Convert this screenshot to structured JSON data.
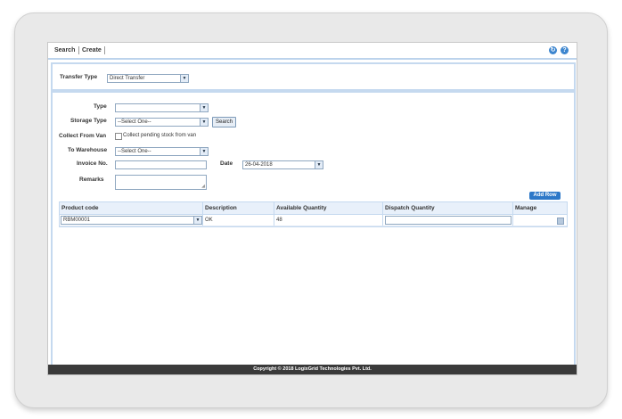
{
  "toolbar": {
    "search": "Search",
    "create": "Create"
  },
  "filter": {
    "label": "Transfer Type",
    "value": "Direct Transfer"
  },
  "form": {
    "type_label": "Type",
    "type_value": "",
    "storage_label": "Storage Type",
    "storage_value": "--Select One--",
    "search_button": "Search",
    "van_label": "Collect From Van",
    "van_checkbox_label": "Collect pending stock from van",
    "warehouse_label": "To Warehouse",
    "warehouse_value": "--Select One--",
    "invoice_label": "Invoice No.",
    "invoice_value": "",
    "date_label": "Date",
    "date_value": "26-04-2018",
    "remarks_label": "Remarks",
    "remarks_value": ""
  },
  "add_row": "Add Row",
  "table": {
    "headers": [
      "Product code",
      "Description",
      "Available Quantity",
      "Dispatch Quantity",
      "Manage"
    ],
    "rows": [
      {
        "product_code": "RBM00001",
        "description": "OK",
        "available_quantity": "48",
        "dispatch_quantity": ""
      }
    ]
  },
  "footer": "Copyright © 2018 LogixGrid Technologies Pvt. Ltd.",
  "icons": {
    "refresh": "refresh-icon",
    "help": "help-icon"
  },
  "colors": {
    "accent": "#2d78c8",
    "panel_border": "#c5d9ef",
    "footer_bg": "#3a3a3a"
  }
}
